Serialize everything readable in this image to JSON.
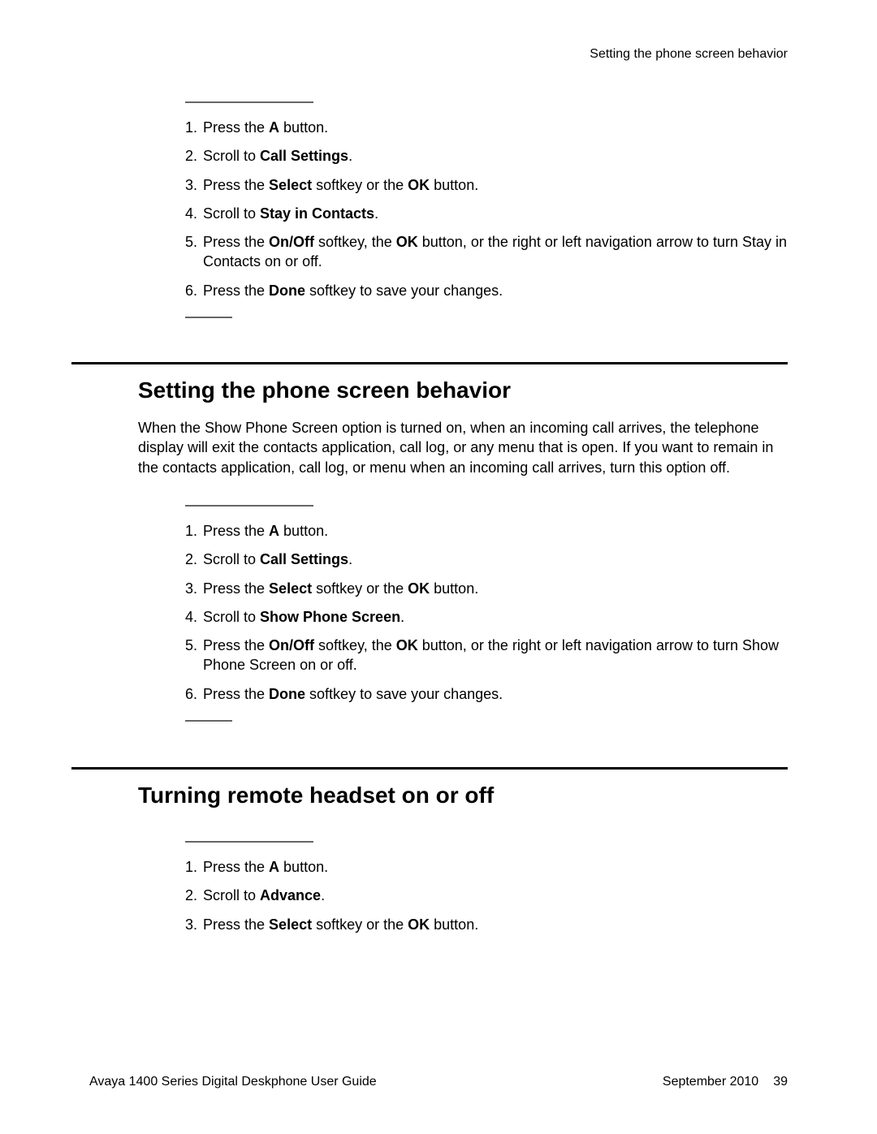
{
  "running_head": "Setting the phone screen behavior",
  "block1": {
    "steps": [
      {
        "pre": "Press the ",
        "bold": "A",
        "post": " button."
      },
      {
        "pre": "Scroll to ",
        "bold": "Call Settings",
        "post": "."
      },
      {
        "pre": "Press the ",
        "bold": "Select",
        "mid": " softkey or the ",
        "bold2": "OK",
        "post": " button."
      },
      {
        "pre": "Scroll to ",
        "bold": "Stay in Contacts",
        "post": "."
      },
      {
        "pre": "Press the ",
        "bold": "On/Off",
        "mid": " softkey, the ",
        "bold2": "OK",
        "post": " button, or the right or left navigation arrow to turn Stay in Contacts on or off."
      },
      {
        "pre": "Press the ",
        "bold": "Done",
        "post": " softkey to save your changes."
      }
    ]
  },
  "section1": {
    "title": "Setting the phone screen behavior",
    "body": "When the Show Phone Screen option is turned on, when an incoming call arrives, the telephone display will exit the contacts application, call log, or any menu that is open. If you want to remain in the contacts application, call log, or menu when an incoming call arrives, turn this option off.",
    "steps": [
      {
        "pre": "Press the ",
        "bold": "A",
        "post": " button."
      },
      {
        "pre": "Scroll to ",
        "bold": "Call Settings",
        "post": "."
      },
      {
        "pre": "Press the ",
        "bold": "Select",
        "mid": " softkey or the ",
        "bold2": "OK",
        "post": " button."
      },
      {
        "pre": "Scroll to ",
        "bold": "Show Phone Screen",
        "post": "."
      },
      {
        "pre": "Press the ",
        "bold": "On/Off",
        "mid": " softkey, the ",
        "bold2": "OK",
        "post": " button, or the right or left navigation arrow to turn Show Phone Screen on or off."
      },
      {
        "pre": "Press the ",
        "bold": "Done",
        "post": " softkey to save your changes."
      }
    ]
  },
  "section2": {
    "title": "Turning remote headset on or off",
    "steps": [
      {
        "pre": "Press the ",
        "bold": "A",
        "post": " button."
      },
      {
        "pre": "Scroll to ",
        "bold": "Advance",
        "post": "."
      },
      {
        "pre": "Press the ",
        "bold": "Select",
        "mid": " softkey or the ",
        "bold2": "OK",
        "post": " button."
      }
    ]
  },
  "footer": {
    "left": "Avaya 1400 Series Digital Deskphone User Guide",
    "date": "September 2010",
    "page": "39"
  }
}
